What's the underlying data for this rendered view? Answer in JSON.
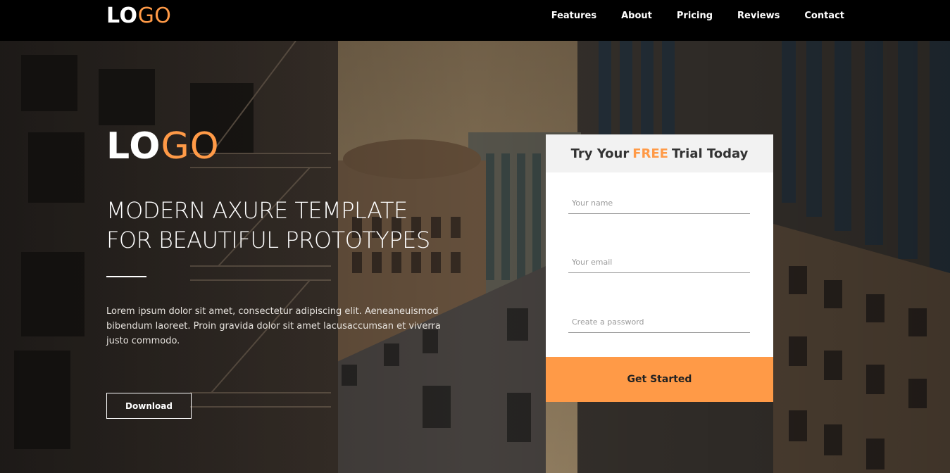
{
  "header": {
    "logo_part1": "LO",
    "logo_part2": "GO",
    "nav": [
      "Features",
      "About",
      "Pricing",
      "Reviews",
      "Contact"
    ]
  },
  "hero": {
    "logo_part1": "LO",
    "logo_part2": "GO",
    "title_line1": "MODERN AXURE TEMPLATE",
    "title_line2": "FOR BEAUTIFUL PROTOTYPES",
    "description": "Lorem ipsum dolor sit amet, consectetur adipiscing elit. Aeneaneuismod bibendum laoreet. Proin gravida dolor sit amet lacusaccumsan et viverra justo commodo.",
    "download_label": "Download"
  },
  "signup": {
    "title_before": "Try Your",
    "title_highlight": "FREE",
    "title_after": "Trial Today",
    "name_placeholder": "Your name",
    "email_placeholder": "Your email",
    "password_placeholder": "Create a password",
    "cta_label": "Get Started"
  },
  "colors": {
    "accent": "#ff9a47",
    "header_bg": "#000000",
    "card_bg": "#ffffff",
    "card_head_bg": "#f2f2f2"
  }
}
